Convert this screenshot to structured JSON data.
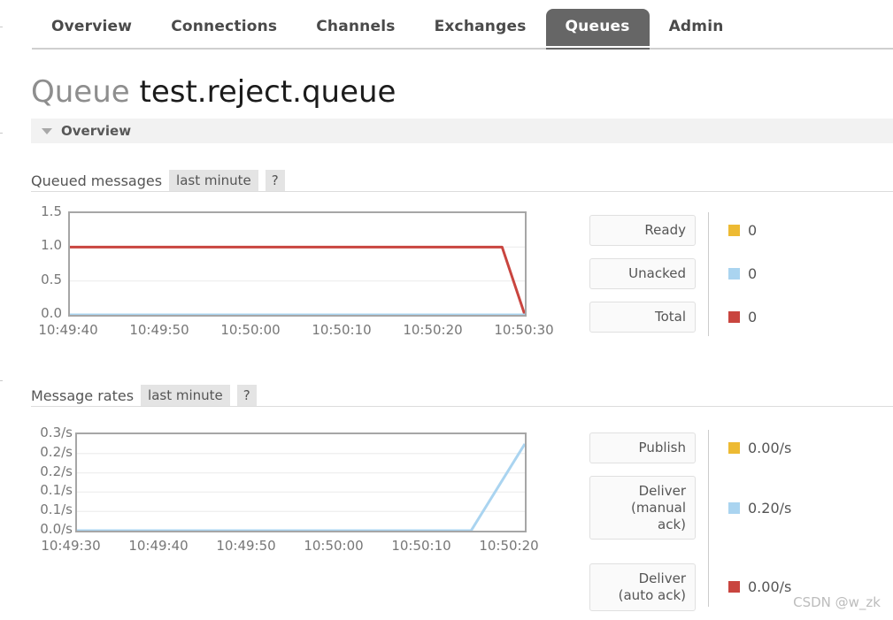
{
  "nav": {
    "tabs": [
      {
        "label": "Overview",
        "active": false
      },
      {
        "label": "Connections",
        "active": false
      },
      {
        "label": "Channels",
        "active": false
      },
      {
        "label": "Exchanges",
        "active": false
      },
      {
        "label": "Queues",
        "active": true
      },
      {
        "label": "Admin",
        "active": false
      }
    ]
  },
  "title": {
    "prefix": "Queue",
    "name": "test.reject.queue"
  },
  "overview_section": {
    "label": "Overview",
    "expanded": true,
    "toggle_icon": "triangle-down-icon"
  },
  "sections": [
    {
      "id": "queued-messages",
      "title": "Queued messages",
      "period": "last minute",
      "help": "?"
    },
    {
      "id": "message-rates",
      "title": "Message rates",
      "period": "last minute",
      "help": "?"
    }
  ],
  "colors": {
    "ready": "#edba33",
    "unacked": "#aad4f0",
    "total": "#c9453f",
    "publish": "#edba33",
    "deliver_manual": "#aad4f0",
    "deliver_auto": "#c9453f",
    "active_tab_bg": "#666666",
    "plot_border": "#a6a6a6",
    "grid": "#f0f0f0"
  },
  "legends": {
    "queued": [
      {
        "label": "Ready",
        "value": "0",
        "color": "#edba33"
      },
      {
        "label": "Unacked",
        "value": "0",
        "color": "#aad4f0"
      },
      {
        "label": "Total",
        "value": "0",
        "color": "#c9453f"
      }
    ],
    "rates": [
      {
        "label": "Publish",
        "value": "0.00/s",
        "color": "#edba33"
      },
      {
        "label": "Deliver\n(manual\nack)",
        "value": "0.20/s",
        "color": "#aad4f0"
      },
      {
        "label": "Deliver\n(auto ack)",
        "value": "0.00/s",
        "color": "#c9453f"
      }
    ]
  },
  "watermark": "CSDN @w_zk",
  "chart_data": [
    {
      "type": "line",
      "id": "queued-messages-chart",
      "title": "Queued messages",
      "period": "last minute",
      "xlabel": "",
      "ylabel": "",
      "ylim": [
        0.0,
        1.5
      ],
      "yticks": [
        0.0,
        0.5,
        1.0,
        1.5
      ],
      "ytick_labels": [
        "0.0",
        "0.5",
        "1.0",
        "1.5"
      ],
      "xtick_labels": [
        "10:49:40",
        "10:49:50",
        "10:50:00",
        "10:50:10",
        "10:50:20",
        "10:50:30"
      ],
      "grid": true,
      "legend_position": "right",
      "series": [
        {
          "name": "Total",
          "color": "#c9453f",
          "x": [
            0,
            1,
            2,
            3,
            4,
            5,
            6,
            7,
            8,
            9,
            9.5,
            10
          ],
          "values": [
            1.0,
            1.0,
            1.0,
            1.0,
            1.0,
            1.0,
            1.0,
            1.0,
            1.0,
            1.0,
            1.0,
            0.0
          ]
        },
        {
          "name": "Unacked",
          "color": "#aad4f0",
          "x": [
            0,
            1,
            2,
            3,
            4,
            5,
            6,
            7,
            8,
            9,
            9.5,
            10
          ],
          "values": [
            0.0,
            0.0,
            0.0,
            0.0,
            0.0,
            0.0,
            0.0,
            0.0,
            0.0,
            0.0,
            0.0,
            0.0
          ]
        },
        {
          "name": "Ready",
          "color": "#edba33",
          "x": [],
          "values": []
        }
      ]
    },
    {
      "type": "line",
      "id": "message-rates-chart",
      "title": "Message rates",
      "period": "last minute",
      "xlabel": "",
      "ylabel": "",
      "ylim": [
        0.0,
        0.3
      ],
      "yticks": [
        0.0,
        0.06,
        0.12,
        0.18,
        0.24,
        0.3
      ],
      "ytick_labels": [
        "0.0/s",
        "0.1/s",
        "0.1/s",
        "0.2/s",
        "0.2/s",
        "0.3/s"
      ],
      "xtick_labels": [
        "10:49:30",
        "10:49:40",
        "10:49:50",
        "10:50:00",
        "10:50:10",
        "10:50:20"
      ],
      "grid": true,
      "legend_position": "right",
      "series": [
        {
          "name": "Deliver (manual ack)",
          "color": "#aad4f0",
          "x": [
            0,
            1,
            2,
            3,
            4,
            5,
            6,
            7,
            8,
            8.8,
            10
          ],
          "values": [
            0.0,
            0.0,
            0.0,
            0.0,
            0.0,
            0.0,
            0.0,
            0.0,
            0.0,
            0.0,
            0.27
          ]
        },
        {
          "name": "Publish",
          "color": "#edba33",
          "x": [],
          "values": []
        },
        {
          "name": "Deliver (auto ack)",
          "color": "#c9453f",
          "x": [],
          "values": []
        }
      ]
    }
  ]
}
